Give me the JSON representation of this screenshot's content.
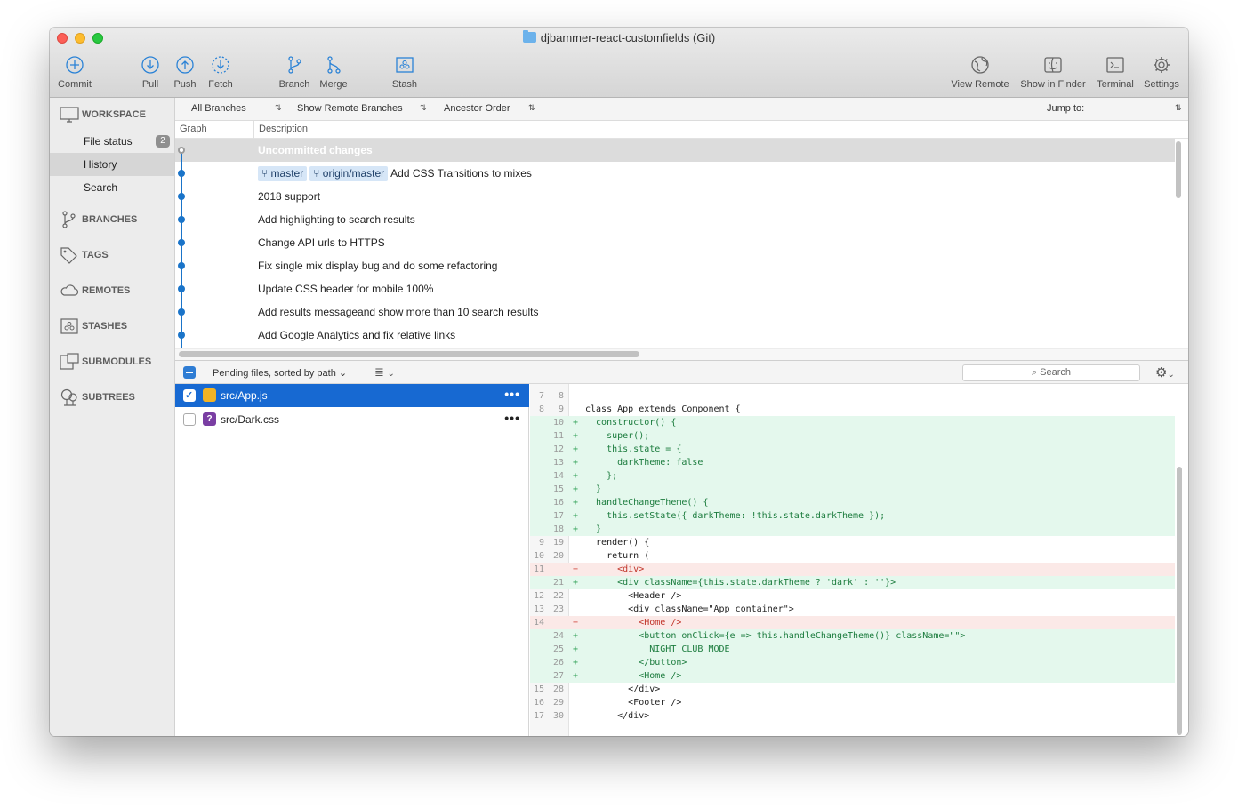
{
  "window": {
    "title": "djbammer-react-customfields (Git)"
  },
  "toolbar": {
    "left": [
      {
        "label": "Commit",
        "icon": "plus-circle-icon"
      },
      {
        "label": "Pull",
        "icon": "arrow-down-circle-icon"
      },
      {
        "label": "Push",
        "icon": "arrow-up-circle-icon"
      },
      {
        "label": "Fetch",
        "icon": "dashed-arrow-down-circle-icon"
      },
      {
        "label": "Branch",
        "icon": "branch-icon"
      },
      {
        "label": "Merge",
        "icon": "merge-icon"
      },
      {
        "label": "Stash",
        "icon": "stash-icon"
      }
    ],
    "right": [
      {
        "label": "View Remote",
        "icon": "globe-icon"
      },
      {
        "label": "Show in Finder",
        "icon": "finder-icon"
      },
      {
        "label": "Terminal",
        "icon": "terminal-icon"
      },
      {
        "label": "Settings",
        "icon": "gear-icon"
      }
    ]
  },
  "sidebar": {
    "workspace": "WORKSPACE",
    "items": [
      {
        "label": "File status",
        "badge": "2"
      },
      {
        "label": "History"
      },
      {
        "label": "Search"
      }
    ],
    "sections": [
      {
        "label": "BRANCHES",
        "icon": "branches-icon"
      },
      {
        "label": "TAGS",
        "icon": "tag-icon"
      },
      {
        "label": "REMOTES",
        "icon": "cloud-icon"
      },
      {
        "label": "STASHES",
        "icon": "stash-box-icon"
      },
      {
        "label": "SUBMODULES",
        "icon": "submodule-icon"
      },
      {
        "label": "SUBTREES",
        "icon": "subtree-icon"
      }
    ]
  },
  "filters": {
    "branches": "All Branches",
    "remote": "Show Remote Branches",
    "order": "Ancestor Order",
    "jump_label": "Jump to:"
  },
  "graph_header": {
    "graph": "Graph",
    "description": "Description"
  },
  "commits": [
    {
      "desc": "Uncommitted changes"
    },
    {
      "desc": "Add CSS Transitions to mixes",
      "tags": [
        "master",
        "origin/master"
      ]
    },
    {
      "desc": "2018 support"
    },
    {
      "desc": "Add highlighting to search results"
    },
    {
      "desc": "Change API urls to HTTPS"
    },
    {
      "desc": "Fix single mix display bug and do some refactoring"
    },
    {
      "desc": "Update CSS header for mobile 100%"
    },
    {
      "desc": "Add results messageand show more than 10 search results"
    },
    {
      "desc": "Add Google Analytics and fix relative links"
    }
  ],
  "files_bar": {
    "sort_label": "Pending files, sorted by path",
    "search_placeholder": "Search"
  },
  "files": [
    {
      "name": "src/App.js",
      "status": "",
      "selected": true
    },
    {
      "name": "src/Dark.css",
      "status": "?",
      "selected": false
    }
  ],
  "diff": [
    {
      "o": "7",
      "n": "8",
      "t": "ctx",
      "code": ""
    },
    {
      "o": "8",
      "n": "9",
      "t": "ctx",
      "code": "class App extends Component {"
    },
    {
      "o": "",
      "n": "10",
      "t": "add",
      "code": "  constructor() {"
    },
    {
      "o": "",
      "n": "11",
      "t": "add",
      "code": "    super();"
    },
    {
      "o": "",
      "n": "12",
      "t": "add",
      "code": "    this.state = {"
    },
    {
      "o": "",
      "n": "13",
      "t": "add",
      "code": "      darkTheme: false"
    },
    {
      "o": "",
      "n": "14",
      "t": "add",
      "code": "    };"
    },
    {
      "o": "",
      "n": "15",
      "t": "add",
      "code": "  }"
    },
    {
      "o": "",
      "n": "16",
      "t": "add",
      "code": "  handleChangeTheme() {"
    },
    {
      "o": "",
      "n": "17",
      "t": "add",
      "code": "    this.setState({ darkTheme: !this.state.darkTheme });"
    },
    {
      "o": "",
      "n": "18",
      "t": "add",
      "code": "  }"
    },
    {
      "o": "9",
      "n": "19",
      "t": "ctx",
      "code": "  render() {"
    },
    {
      "o": "10",
      "n": "20",
      "t": "ctx",
      "code": "    return ("
    },
    {
      "o": "11",
      "n": "",
      "t": "del",
      "code": "      <div>"
    },
    {
      "o": "",
      "n": "21",
      "t": "add",
      "code": "      <div className={this.state.darkTheme ? 'dark' : ''}>"
    },
    {
      "o": "12",
      "n": "22",
      "t": "ctx",
      "code": "        <Header />"
    },
    {
      "o": "13",
      "n": "23",
      "t": "ctx",
      "code": "        <div className=\"App container\">"
    },
    {
      "o": "14",
      "n": "",
      "t": "del",
      "code": "          <Home />"
    },
    {
      "o": "",
      "n": "24",
      "t": "add",
      "code": "          <button onClick={e => this.handleChangeTheme()} className=\"\">"
    },
    {
      "o": "",
      "n": "25",
      "t": "add",
      "code": "            NIGHT CLUB MODE"
    },
    {
      "o": "",
      "n": "26",
      "t": "add",
      "code": "          </button>"
    },
    {
      "o": "",
      "n": "27",
      "t": "add",
      "code": "          <Home />"
    },
    {
      "o": "15",
      "n": "28",
      "t": "ctx",
      "code": "        </div>"
    },
    {
      "o": "16",
      "n": "29",
      "t": "ctx",
      "code": "        <Footer />"
    },
    {
      "o": "17",
      "n": "30",
      "t": "ctx",
      "code": "      </div>"
    }
  ]
}
